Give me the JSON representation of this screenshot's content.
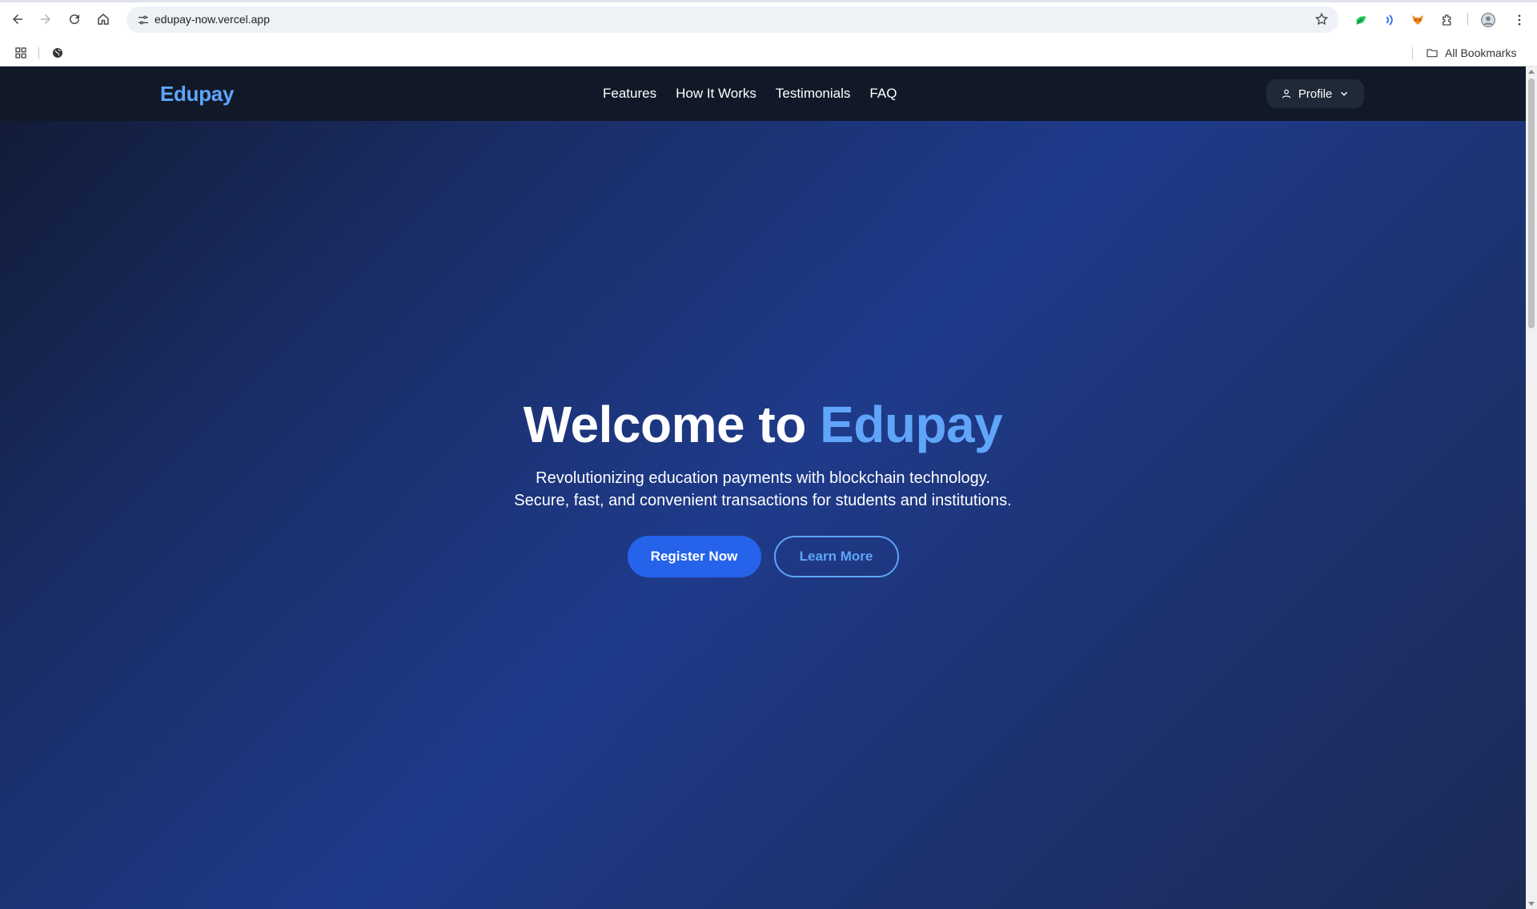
{
  "browser": {
    "url": "edupay-now.vercel.app",
    "bookmarks_folder_label": "All Bookmarks",
    "icons": [
      "back-arrow-icon",
      "forward-arrow-icon",
      "reload-icon",
      "home-icon",
      "site-info-icon",
      "bookmark-star-icon",
      "extensions-puzzle-icon",
      "profile-avatar-icon",
      "kebab-menu-icon"
    ]
  },
  "site": {
    "logo": "Edupay",
    "nav": [
      "Features",
      "How It Works",
      "Testimonials",
      "FAQ"
    ],
    "profile_label": "Profile"
  },
  "hero": {
    "title_prefix": "Welcome to",
    "title_accent": "Edupay",
    "subtitle_line1": "Revolutionizing education payments with blockchain technology.",
    "subtitle_line2": "Secure, fast, and convenient transactions for students and institutions.",
    "primary_cta": "Register Now",
    "secondary_cta": "Learn More"
  },
  "colors": {
    "accent": "#60a5fa",
    "primary_button": "#2563eb",
    "navbar": "#111827"
  }
}
